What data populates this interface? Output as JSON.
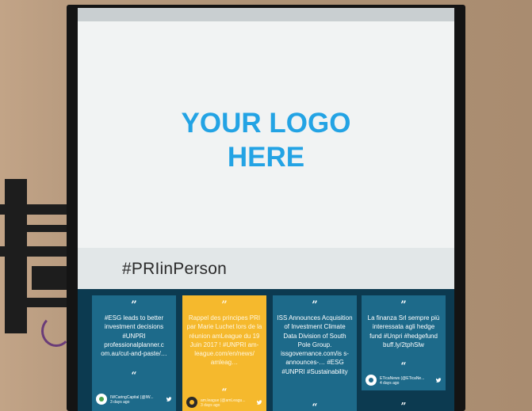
{
  "display": {
    "logo_line1": "YOUR LOGO",
    "logo_line2": "HERE",
    "hashtag": "#PRIinPerson",
    "logo_color": "#23a3e4"
  },
  "feed": {
    "quote_glyph": "“”",
    "quote_mark": "”",
    "open_quote": "“",
    "cards": [
      {
        "text": "#ESG leads to better investment decisions #UNPRI professionalplanner.c om.au/cut-and-paste/…",
        "author": "IWCaringCapital (@IW...",
        "time": "3 days ago",
        "color": "#1d6a8a",
        "icon": "twitter-icon"
      },
      {
        "text": "Rappel des principes PRI par Marie Luchet lors de la réunion amLeague du 19 Juin 2017 ! #UNPRI am-league.com/en/news/ amleag…",
        "author": "am.league (@amLeagu...",
        "time": "3 days ago",
        "color": "#f5b92d",
        "icon": "twitter-icon"
      },
      {
        "text": "ISS Announces Acquisition of Investment Climate Data Division of South Pole Group. issgovernance.com/is s-announces-… #ESG #UNPRI #Sustainability",
        "color": "#1d6a8a"
      },
      {
        "text": "La finanza Srl sempre più interessata agli hedge fund #Unpri #hedgefund buff.ly/2tphSlw",
        "author": "ETicaNews (@ETicaNe...",
        "time": "4 days ago",
        "color": "#1d6a8a",
        "icon": "twitter-icon"
      }
    ]
  }
}
